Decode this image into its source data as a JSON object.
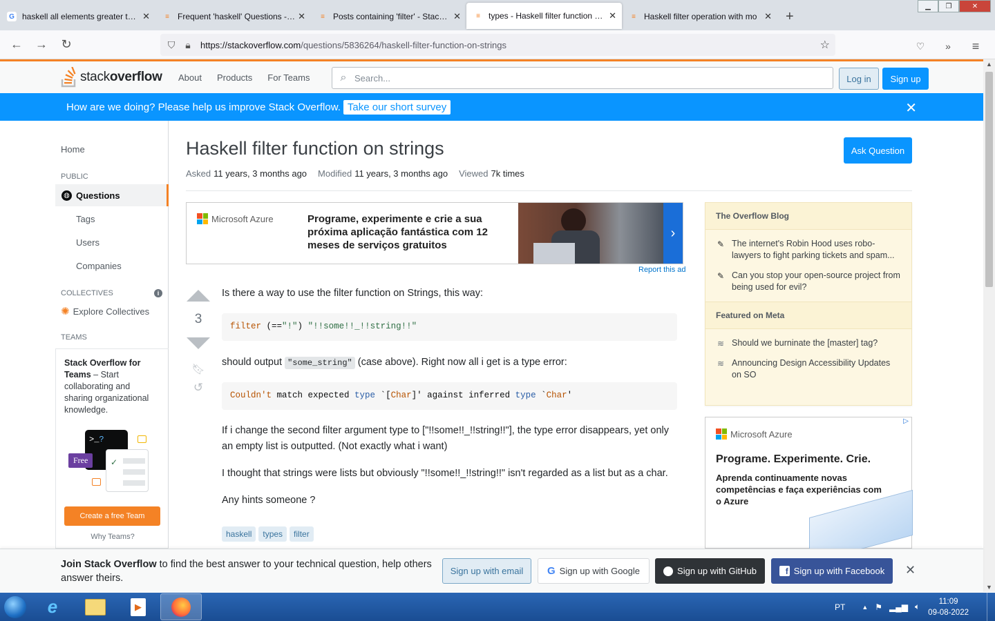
{
  "browser": {
    "tabs": [
      {
        "label": "haskell all elements greater than",
        "icon": "google-icon"
      },
      {
        "label": "Frequent 'haskell' Questions - Page",
        "icon": "stackoverflow-icon"
      },
      {
        "label": "Posts containing 'filter' - Stack Ov",
        "icon": "stackoverflow-icon"
      },
      {
        "label": "types - Haskell filter function on st",
        "icon": "stackoverflow-icon",
        "active": true
      },
      {
        "label": "Haskell filter operation with mo",
        "icon": "stackoverflow-icon"
      }
    ],
    "new_tab": "+",
    "url_host": "https://stackoverflow.com",
    "url_path": "/questions/5836264/haskell-filter-function-on-strings"
  },
  "header": {
    "logo_light": "stack",
    "logo_bold": "overflow",
    "nav": [
      "About",
      "Products",
      "For Teams"
    ],
    "search_placeholder": "Search...",
    "login": "Log in",
    "signup": "Sign up"
  },
  "survey": {
    "text": "How are we doing? Please help us improve Stack Overflow.",
    "button": "Take our short survey",
    "close": "✕"
  },
  "sidebar": {
    "home": "Home",
    "public": "PUBLIC",
    "questions": "Questions",
    "tags": "Tags",
    "users": "Users",
    "companies": "Companies",
    "collectives": "COLLECTIVES",
    "explore": "Explore Collectives",
    "teams": "TEAMS",
    "teams_title": "Stack Overflow for Teams",
    "teams_desc": " – Start collaborating and sharing organizational knowledge.",
    "free": "Free",
    "create": "Create a free Team",
    "why": "Why Teams?"
  },
  "question": {
    "title": "Haskell filter function on strings",
    "ask_button": "Ask Question",
    "asked_label": "Asked",
    "asked": "11 years, 3 months ago",
    "modified_label": "Modified",
    "modified": "11 years, 3 months ago",
    "viewed_label": "Viewed",
    "viewed": "7k times",
    "votes": "3",
    "p1": "Is there a way to use the filter function on Strings, this way:",
    "code1_fn": "filter",
    "code1_rest": " (==",
    "code1_s1": "\"!\"",
    "code1_mid": ") ",
    "code1_s2": "\"!!some!!_!!string!!\"",
    "p2_pre": "should output ",
    "p2_code": "\"some_string\"",
    "p2_post": " (case above). Right now all i get is a type error:",
    "code2_a": "Couldn't",
    "code2_b": " match expected ",
    "code2_c": "type",
    "code2_d": " `[",
    "code2_e": "Char",
    "code2_f": "]' against inferred ",
    "code2_g": "type",
    "code2_h": " `",
    "code2_i": "Char",
    "code2_j": "'",
    "p3": "If i change the second filter argument type to [\"!!some!!_!!string!!\"], the type error disappears, yet only an empty list is outputted. (Not exactly what i want)",
    "p4": "I thought that strings were lists but obviously \"!!some!!_!!string!!\" isn't regarded as a list but as a char.",
    "p5": "Any hints someone ?",
    "tags": [
      "haskell",
      "types",
      "filter"
    ]
  },
  "ad_top": {
    "brand": "Microsoft Azure",
    "text": "Programe, experimente e crie a sua próxima aplicação fantástica com 12 meses de serviços gratuitos",
    "report": "Report this ad"
  },
  "blog": {
    "title": "The Overflow Blog",
    "items": [
      "The internet's Robin Hood uses robo-lawyers to fight parking tickets and spam...",
      "Can you stop your open-source project from being used for evil?"
    ],
    "meta_title": "Featured on Meta",
    "meta_items": [
      "Should we burninate the [master] tag?",
      "Announcing Design Accessibility Updates on SO"
    ]
  },
  "ad_side": {
    "brand": "Microsoft Azure",
    "h1": "Programe. Experimente. Crie.",
    "h2": "Aprenda continuamente novas competências e faça experiências com o Azure"
  },
  "join": {
    "bold": "Join Stack Overflow",
    "rest": " to find the best answer to your technical question, help others answer theirs.",
    "email": "Sign up with email",
    "google": "Sign up with Google",
    "github": "Sign up with GitHub",
    "facebook": "Sign up with Facebook"
  },
  "taskbar": {
    "lang": "PT",
    "time": "11:09",
    "date": "09-08-2022"
  },
  "colors": {
    "accent": "#f48225",
    "blue": "#0a95ff"
  }
}
